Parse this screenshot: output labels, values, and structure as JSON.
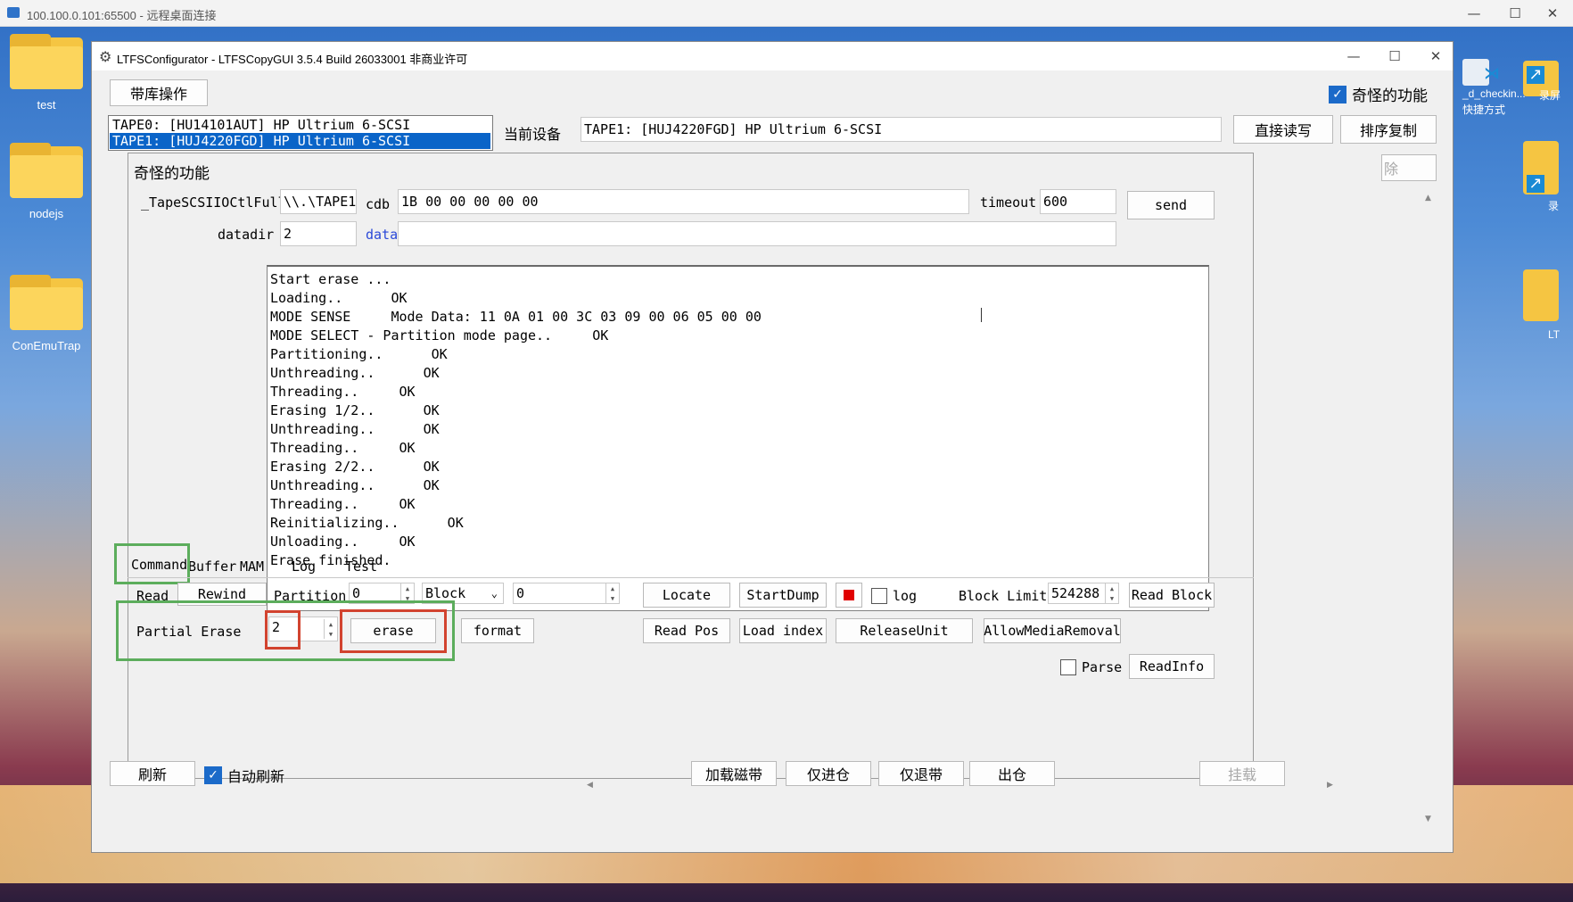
{
  "rdp": {
    "title": "100.100.0.101:65500 - 远程桌面连接"
  },
  "desktop": {
    "icons": [
      {
        "label": "test"
      },
      {
        "label": "nodejs"
      },
      {
        "label": "ConEmuTrap"
      }
    ],
    "right_labels": [
      "_d_checkin...",
      "快捷方式",
      "录屏",
      "录",
      "LT"
    ]
  },
  "app": {
    "title": "LTFSConfigurator - LTFSCopyGUI 3.5.4 Build 26033001 非商业许可",
    "library_button": "带库操作",
    "weird_checkbox_label": "奇怪的功能",
    "devices": [
      "TAPE0: [HU14101AUT] HP Ultrium 6-SCSI",
      "TAPE1: [HUJ4220FGD] HP Ultrium 6-SCSI"
    ],
    "current_device_label": "当前设备",
    "current_device_value": "TAPE1: [HUJ4220FGD] HP Ultrium 6-SCSI",
    "direct_rw_button": "直接读写",
    "sort_copy_button": "排序复制",
    "partial_hidden_button": "除",
    "bottom": {
      "refresh": "刷新",
      "auto_refresh": "自动刷新",
      "load_tape": "加载磁带",
      "only_in": "仅进仓",
      "only_eject": "仅退带",
      "out": "出仓",
      "mount": "挂载"
    }
  },
  "weird": {
    "title": "奇怪的功能",
    "ioctl_label": "_TapeSCSIIOCtlFull",
    "ioctl_value": "\\\\.\\TAPE1",
    "cdb_label": "cdb",
    "cdb_value": "1B 00 00 00 00 00",
    "timeout_label": "timeout",
    "timeout_value": "600",
    "send_button": "send",
    "datadir_label": "datadir",
    "datadir_value": "2",
    "data_label": "data",
    "data_value": "",
    "log_lines": [
      "Start erase ...",
      "Loading..      OK",
      "MODE SENSE     Mode Data: 11 0A 01 00 3C 03 09 00 06 05 00 00",
      "MODE SELECT - Partition mode page..     OK",
      "Partitioning..      OK",
      "Unthreading..      OK",
      "Threading..     OK",
      "Erasing 1/2..      OK",
      "Unthreading..      OK",
      "Threading..     OK",
      "Erasing 2/2..      OK",
      "Unthreading..      OK",
      "Threading..     OK",
      "Reinitializing..      OK",
      "Unloading..     OK",
      "Erase finished."
    ],
    "tabs": [
      "Command",
      "Buffer",
      "MAM",
      "Log",
      "Test"
    ],
    "command": {
      "read": "Read",
      "rewind": "Rewind",
      "partition_label": "Partition",
      "partition_value": "0",
      "block_select": "Block",
      "block_value": "0",
      "locate": "Locate",
      "startdump": "StartDump",
      "log_label": "log",
      "block_limit_label": "Block Limit",
      "block_limit_value": "524288",
      "read_block": "Read Block",
      "partial_erase_label": "Partial Erase",
      "partial_erase_value": "2",
      "erase": "erase",
      "format": "format",
      "read_pos": "Read Pos",
      "load_index": "Load index",
      "release_unit": "ReleaseUnit",
      "allow_media_removal": "AllowMediaRemoval",
      "parse_label": "Parse",
      "read_info": "ReadInfo"
    }
  },
  "colors": {
    "selection": "#0a64c8",
    "highlight_green": "#5cad5c",
    "highlight_red": "#d2432f",
    "checkbox_on": "#1b6ac9"
  }
}
